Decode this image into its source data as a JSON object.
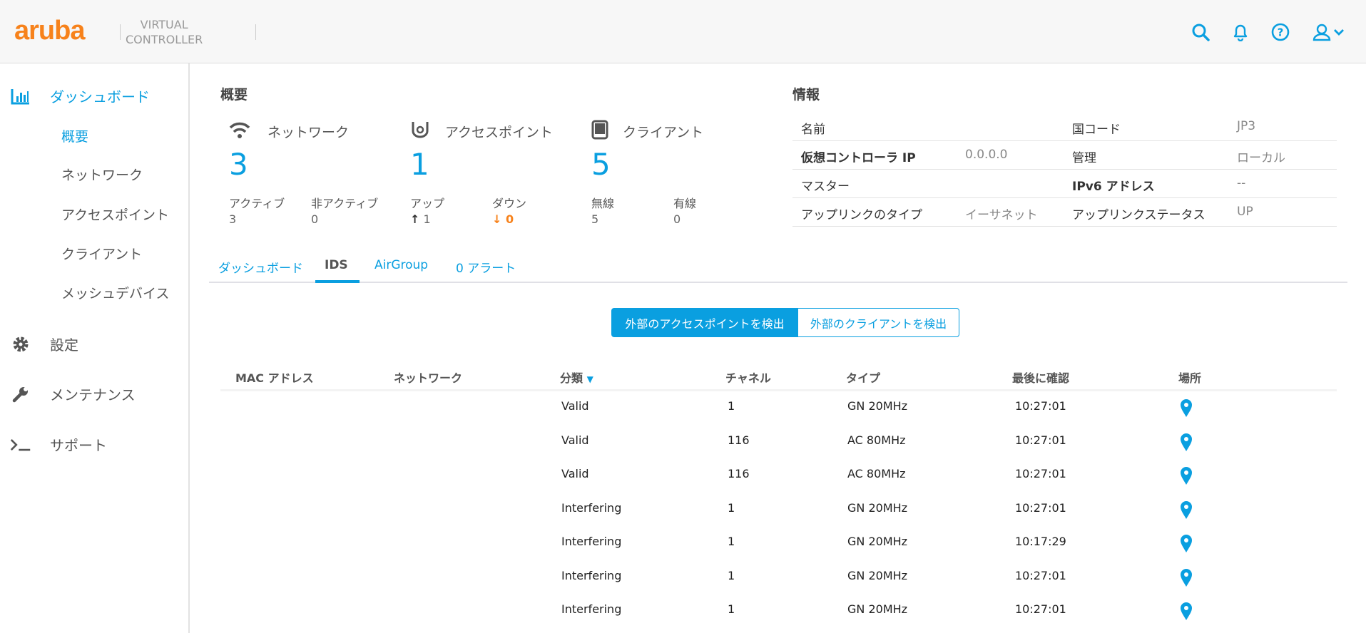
{
  "header": {
    "logo": "aruba",
    "product_line1": "VIRTUAL",
    "product_line2": "CONTROLLER",
    "icons": [
      "search-icon",
      "bell-icon",
      "help-icon",
      "user-icon"
    ]
  },
  "sidebar": {
    "dashboard": "ダッシュボード",
    "sub": [
      "概要",
      "ネットワーク",
      "アクセスポイント",
      "クライアント",
      "メッシュデバイス"
    ],
    "settings": "設定",
    "maintenance": "メンテナンス",
    "support": "サポート"
  },
  "overview": {
    "title": "概要",
    "network": {
      "label": "ネットワーク",
      "count": "3",
      "a_label": "アクティブ",
      "a_val": "3",
      "b_label": "非アクティブ",
      "b_val": "0"
    },
    "ap": {
      "label": "アクセスポイント",
      "count": "1",
      "a_label": "アップ",
      "a_val": "1",
      "b_label": "ダウン",
      "b_val": "0"
    },
    "client": {
      "label": "クライアント",
      "count": "5",
      "a_label": "無線",
      "a_val": "5",
      "b_label": "有線",
      "b_val": "0"
    }
  },
  "info": {
    "title": "情報",
    "rows": [
      {
        "k1": "名前",
        "v1": "",
        "k2": "国コード",
        "v2": "JP3"
      },
      {
        "k1": "仮想コントローラ IP",
        "v1": "0.0.0.0",
        "k2": "管理",
        "v2": "ローカル"
      },
      {
        "k1": "マスター",
        "v1": "",
        "k2": "IPv6 アドレス",
        "v2": "--"
      },
      {
        "k1": "アップリンクのタイプ",
        "v1": "イーサネット",
        "k2": "アップリンクステータス",
        "v2": "UP"
      }
    ]
  },
  "tabs": [
    "ダッシュボード",
    "IDS",
    "AirGroup",
    "0 アラート"
  ],
  "active_tab": "IDS",
  "toggle": {
    "ap": "外部のアクセスポイントを検出",
    "client": "外部のクライアントを検出",
    "selected": "ap"
  },
  "table": {
    "headers": [
      "MAC アドレス",
      "ネットワーク",
      "分類",
      "チャネル",
      "タイプ",
      "最後に確認",
      "場所"
    ],
    "sort_column": "分類",
    "sort_dir": "desc",
    "rows": [
      {
        "mac": "",
        "network": "",
        "class": "Valid",
        "channel": "1",
        "type": "GN 20MHz",
        "last": "10:27:01"
      },
      {
        "mac": "",
        "network": "",
        "class": "Valid",
        "channel": "116",
        "type": "AC 80MHz",
        "last": "10:27:01"
      },
      {
        "mac": "",
        "network": "",
        "class": "Valid",
        "channel": "116",
        "type": "AC 80MHz",
        "last": "10:27:01"
      },
      {
        "mac": "",
        "network": "",
        "class": "Interfering",
        "channel": "1",
        "type": "GN 20MHz",
        "last": "10:27:01"
      },
      {
        "mac": "",
        "network": "",
        "class": "Interfering",
        "channel": "1",
        "type": "GN 20MHz",
        "last": "10:17:29"
      },
      {
        "mac": "",
        "network": "",
        "class": "Interfering",
        "channel": "1",
        "type": "GN 20MHz",
        "last": "10:27:01"
      },
      {
        "mac": "",
        "network": "",
        "class": "Interfering",
        "channel": "1",
        "type": "GN 20MHz",
        "last": "10:27:01"
      }
    ]
  },
  "colors": {
    "accent": "#0a9fe0",
    "brand": "#f7821b",
    "down": "#f7821b"
  }
}
